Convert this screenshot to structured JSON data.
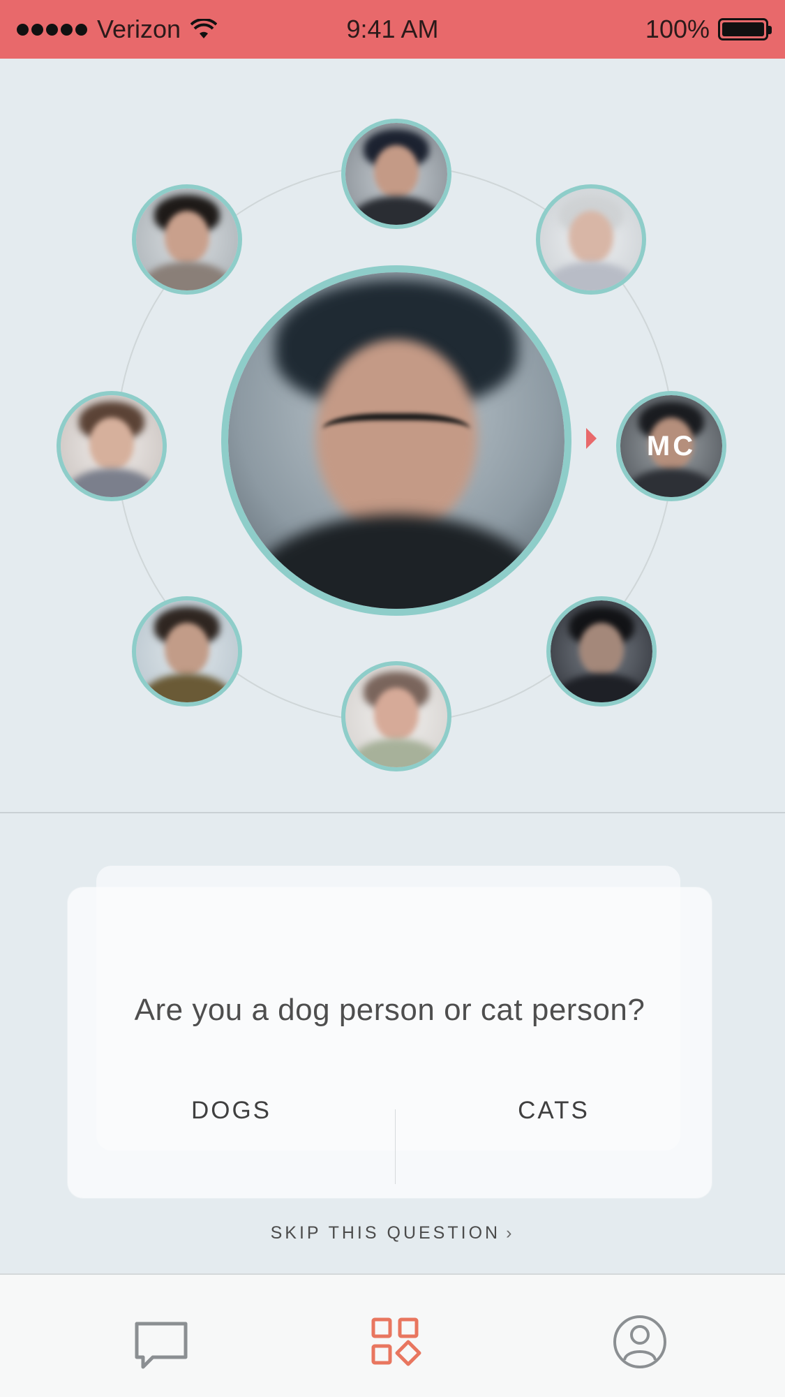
{
  "status_bar": {
    "carrier": "Verizon",
    "time": "9:41 AM",
    "battery": "100%"
  },
  "orbit": {
    "selected_initials": "MC"
  },
  "question_card": {
    "question": "Are you a dog person or cat person?",
    "answers": [
      "DOGS",
      "CATS"
    ]
  },
  "skip_label": "SKIP THIS QUESTION",
  "tabs": [
    {
      "icon": "chat-bubble-icon",
      "active": false
    },
    {
      "icon": "grid-icon",
      "active": true
    },
    {
      "icon": "profile-icon",
      "active": false
    }
  ],
  "colors": {
    "accent": "#e8696b",
    "ring": "#8ecdc9",
    "active_tab": "#e8765f",
    "inactive_tab": "#8b8f92"
  }
}
